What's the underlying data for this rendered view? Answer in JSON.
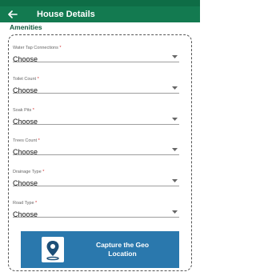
{
  "header": {
    "title": "House Details",
    "back_icon": "arrow-left-icon"
  },
  "section": {
    "title": "Amenities"
  },
  "fields": [
    {
      "label": "Water Tap Connections",
      "required": "*",
      "value": "Choose"
    },
    {
      "label": "Toilet Count",
      "required": "*",
      "value": "Choose"
    },
    {
      "label": "Soak Pits",
      "required": "*",
      "value": "Choose"
    },
    {
      "label": "Trees Count",
      "required": "*",
      "value": "Choose"
    },
    {
      "label": "Drainage Type",
      "required": "*",
      "value": "Choose"
    },
    {
      "label": "Road Type",
      "required": "*",
      "value": "Choose"
    }
  ],
  "geo_button": {
    "label_line1": "Capture the Geo",
    "label_line2": "Location",
    "icon": "location-pin-icon"
  },
  "colors": {
    "appbar": "#137a50",
    "statusbar": "#0e6d46",
    "geo_button": "#2a78ad",
    "required": "#d32f2f"
  }
}
